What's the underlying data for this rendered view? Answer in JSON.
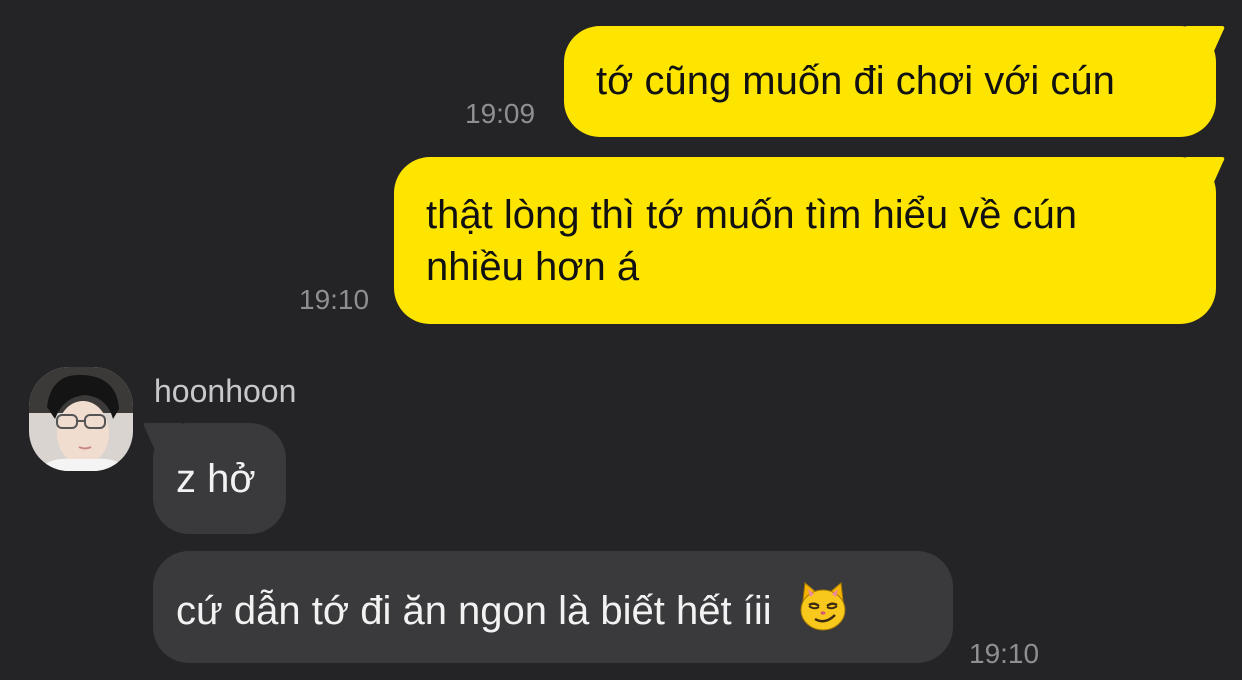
{
  "messages": [
    {
      "direction": "sent",
      "text": "tớ cũng muốn đi chơi với cún",
      "time": "19:09"
    },
    {
      "direction": "sent",
      "text_line1": "thật lòng thì tớ muốn tìm hiểu về cún",
      "text_line2": "nhiều hơn á",
      "time": "19:10"
    },
    {
      "direction": "received",
      "sender": "hoonhoon",
      "text": "z hở"
    },
    {
      "direction": "received",
      "text": "cứ dẫn tớ đi ăn ngon là biết hết íii",
      "emoji": "smirking-cat-emoji",
      "time": "19:10"
    }
  ],
  "colors": {
    "background": "#242426",
    "sent_bubble": "#FEE500",
    "received_bubble": "#3a3a3c",
    "timestamp": "#8e8e93"
  }
}
